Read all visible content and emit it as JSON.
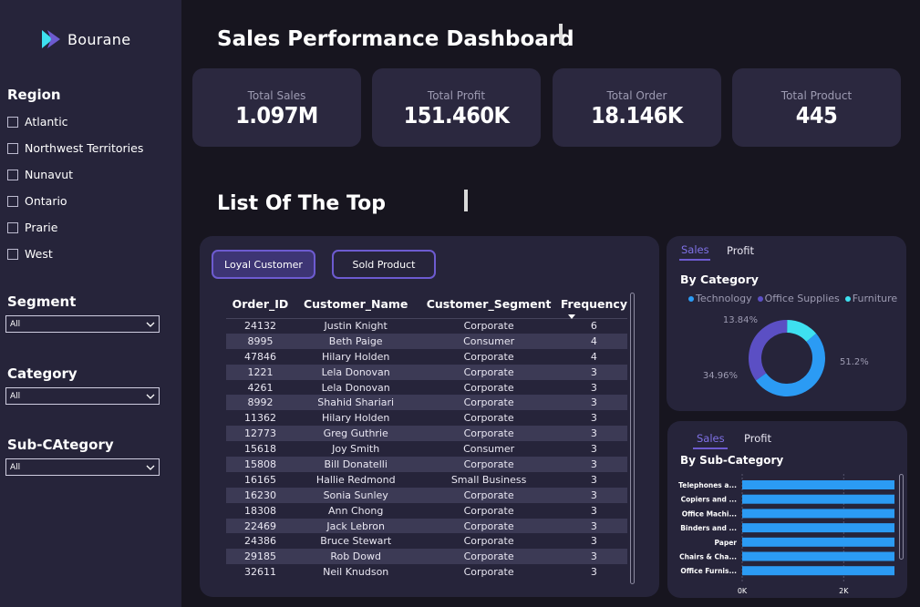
{
  "brand": {
    "name": "Bourane",
    "accent": "#6d5bd0"
  },
  "sidebar": {
    "region_title": "Region",
    "regions": [
      "Atlantic",
      "Northwest Territories",
      "Nunavut",
      "Ontario",
      "Prarie",
      "West"
    ],
    "segment": {
      "title": "Segment",
      "value": "All"
    },
    "category": {
      "title": "Category",
      "value": "All"
    },
    "subcategory": {
      "title": "Sub-CAtegory",
      "value": "All"
    }
  },
  "header": {
    "title": "Sales Performance Dashboard"
  },
  "kpis": [
    {
      "label": "Total Sales",
      "value": "1.097M"
    },
    {
      "label": "Total Profit",
      "value": "151.460K"
    },
    {
      "label": "Total Order",
      "value": "18.146K"
    },
    {
      "label": "Total Product",
      "value": "445"
    }
  ],
  "list_section": {
    "title": "List Of The Top"
  },
  "table": {
    "buttons": {
      "loyal": "Loyal Customer",
      "sold": "Sold Product"
    },
    "columns": [
      "Order_ID",
      "Customer_Name",
      "Customer_Segment",
      "Frequency"
    ],
    "rows": [
      [
        "24132",
        "Justin Knight",
        "Corporate",
        "6"
      ],
      [
        "8995",
        "Beth Paige",
        "Consumer",
        "4"
      ],
      [
        "47846",
        "Hilary Holden",
        "Corporate",
        "4"
      ],
      [
        "1221",
        "Lela Donovan",
        "Corporate",
        "3"
      ],
      [
        "4261",
        "Lela Donovan",
        "Corporate",
        "3"
      ],
      [
        "8992",
        "Shahid Shariari",
        "Corporate",
        "3"
      ],
      [
        "11362",
        "Hilary Holden",
        "Corporate",
        "3"
      ],
      [
        "12773",
        "Greg Guthrie",
        "Corporate",
        "3"
      ],
      [
        "15618",
        "Joy Smith",
        "Consumer",
        "3"
      ],
      [
        "15808",
        "Bill Donatelli",
        "Corporate",
        "3"
      ],
      [
        "16165",
        "Hallie Redmond",
        "Small Business",
        "3"
      ],
      [
        "16230",
        "Sonia Sunley",
        "Corporate",
        "3"
      ],
      [
        "18308",
        "Ann Chong",
        "Corporate",
        "3"
      ],
      [
        "22469",
        "Jack Lebron",
        "Corporate",
        "3"
      ],
      [
        "24386",
        "Bruce Stewart",
        "Corporate",
        "3"
      ],
      [
        "29185",
        "Rob Dowd",
        "Corporate",
        "3"
      ],
      [
        "32611",
        "Neil Knudson",
        "Corporate",
        "3"
      ]
    ]
  },
  "category_card": {
    "tabs": [
      "Sales",
      "Profit"
    ],
    "title": "By Category",
    "legend": [
      {
        "name": "Technology",
        "color": "#2b9bf4"
      },
      {
        "name": "Office Supplies",
        "color": "#5b4fc4"
      },
      {
        "name": "Furniture",
        "color": "#3ee0f0"
      }
    ]
  },
  "subcategory_card": {
    "tabs": [
      "Sales",
      "Profit"
    ],
    "title": "By Sub-Category"
  },
  "chart_data": [
    {
      "type": "pie",
      "title": "By Category",
      "categories": [
        "Technology",
        "Office Supplies",
        "Furniture"
      ],
      "values": [
        51.2,
        34.96,
        13.84
      ],
      "labels": [
        "51.2%",
        "34.96%",
        "13.84%"
      ],
      "colors": [
        "#2b9bf4",
        "#5b4fc4",
        "#3ee0f0"
      ],
      "legend": "top"
    },
    {
      "type": "bar",
      "orientation": "horizontal",
      "title": "By Sub-Category",
      "categories": [
        "Telephones a...",
        "Copiers and ...",
        "Office Machi...",
        "Binders and ...",
        "Paper",
        "Chairs & Cha...",
        "Office Furnis..."
      ],
      "values": [
        3000,
        3000,
        3000,
        3000,
        3000,
        3000,
        3000
      ],
      "xticks": [
        "0K",
        "2K"
      ],
      "xlim": [
        0,
        3000
      ],
      "color": "#2b9bf4"
    }
  ]
}
